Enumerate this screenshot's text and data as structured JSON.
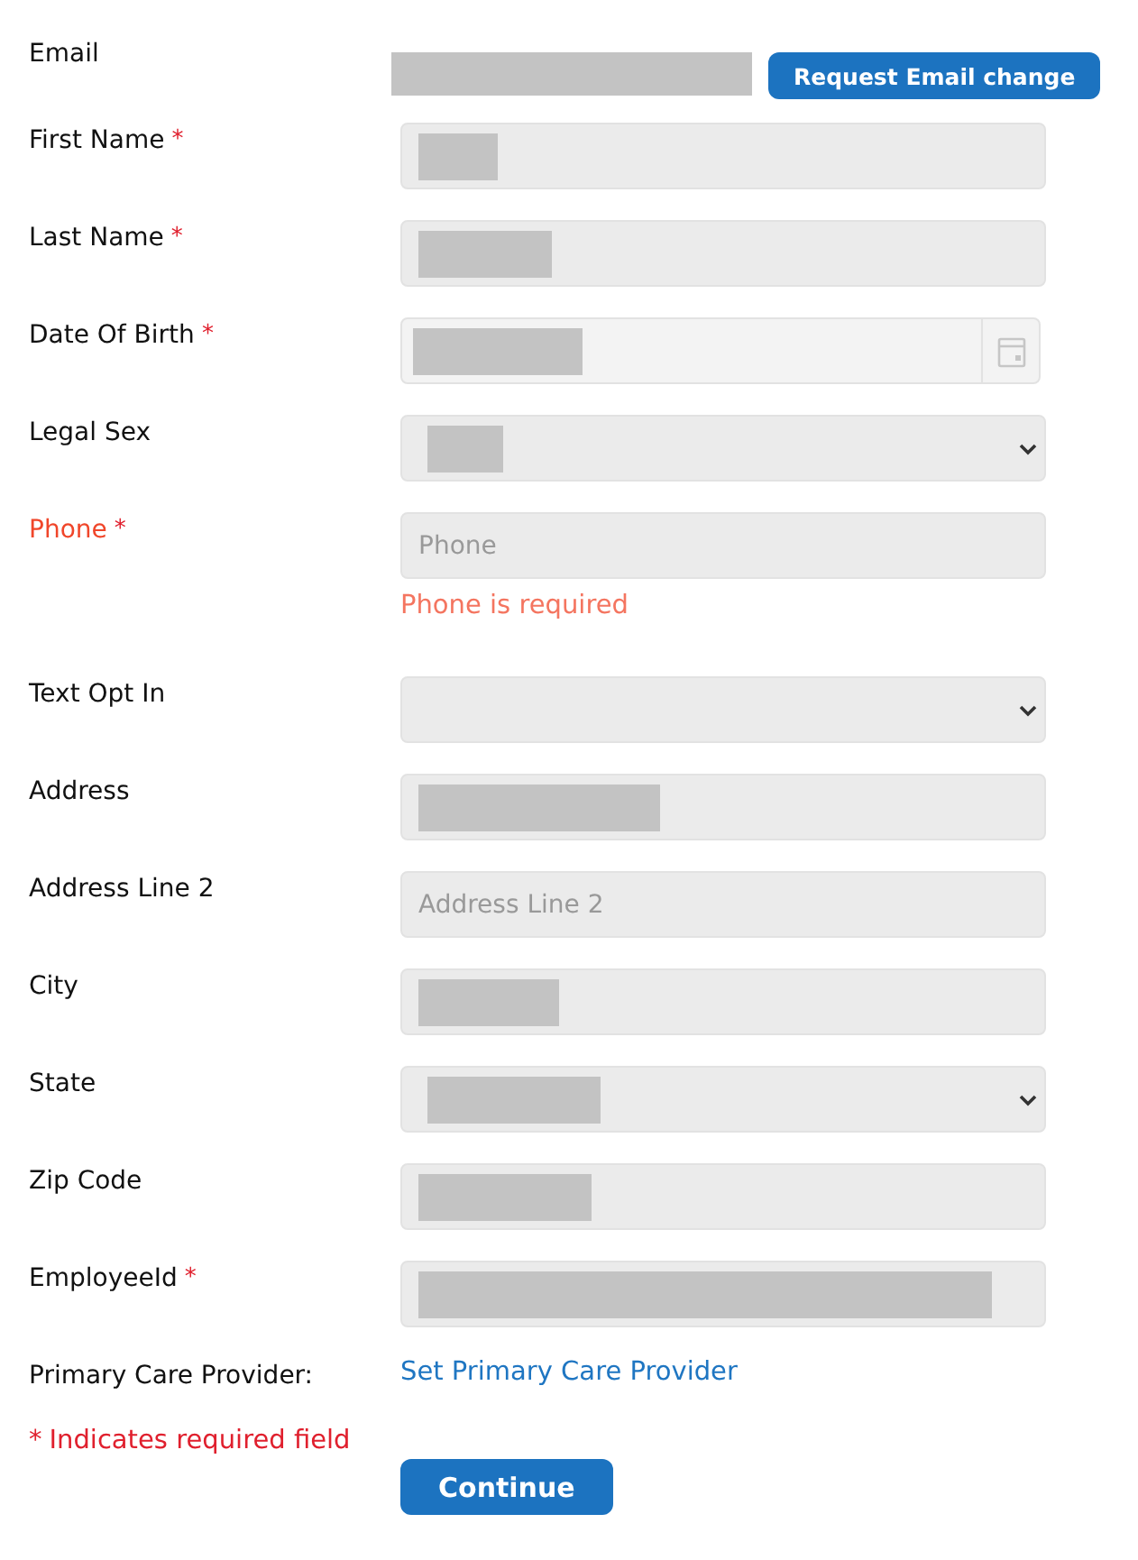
{
  "email": {
    "label": "Email",
    "value_redacted": true,
    "button": "Request Email change"
  },
  "fields": [
    {
      "label": "First Name",
      "kind": "text",
      "required": true,
      "invalid": false,
      "value_redacted": true
    },
    {
      "label": "Last Name",
      "kind": "text",
      "required": true,
      "invalid": false,
      "value_redacted": true
    },
    {
      "label": "Date Of Birth",
      "kind": "date",
      "required": true,
      "invalid": false,
      "value_redacted": true
    },
    {
      "label": "Legal Sex",
      "kind": "select",
      "required": false,
      "invalid": false,
      "value_redacted": true
    },
    {
      "label": "Phone",
      "kind": "text",
      "required": true,
      "invalid": true,
      "value_redacted": false,
      "placeholder": "Phone",
      "error": "Phone is required"
    },
    {
      "label": "Text Opt In",
      "kind": "select",
      "required": false,
      "invalid": false,
      "value_redacted": false
    },
    {
      "label": "Address",
      "kind": "text",
      "required": false,
      "invalid": false,
      "value_redacted": true
    },
    {
      "label": "Address Line 2",
      "kind": "text",
      "required": false,
      "invalid": false,
      "value_redacted": false,
      "placeholder": "Address Line 2"
    },
    {
      "label": "City",
      "kind": "text",
      "required": false,
      "invalid": false,
      "value_redacted": true
    },
    {
      "label": "State",
      "kind": "select",
      "required": false,
      "invalid": false,
      "value_redacted": true
    },
    {
      "label": "Zip Code",
      "kind": "text",
      "required": false,
      "invalid": false,
      "value_redacted": true
    },
    {
      "label": "EmployeeId",
      "kind": "text",
      "required": true,
      "invalid": false,
      "value_redacted": true
    }
  ],
  "provider": {
    "label": "Primary Care Provider:",
    "link": "Set Primary Care Provider"
  },
  "required_note": {
    "mark": "*",
    "text": "Indicates required field"
  },
  "continue_button": "Continue"
}
